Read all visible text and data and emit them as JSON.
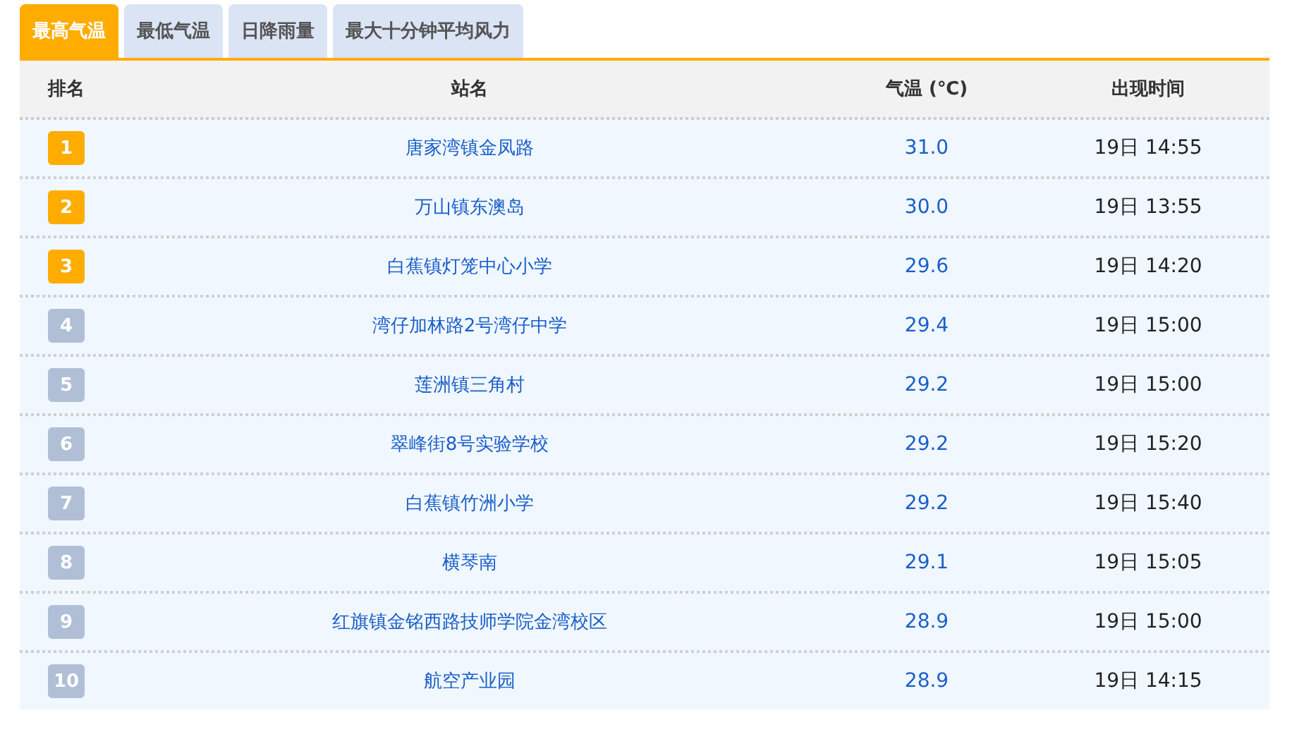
{
  "tabs": [
    {
      "label": "最高气温",
      "selected": true
    },
    {
      "label": "最低气温",
      "selected": false
    },
    {
      "label": "日降雨量",
      "selected": false
    },
    {
      "label": "最大十分钟平均风力",
      "selected": false
    }
  ],
  "table": {
    "columns": [
      "排名",
      "站名",
      "气温 (℃)",
      "出现时间"
    ],
    "rows": [
      {
        "rank": "1",
        "color": "#ffac00",
        "station": "唐家湾镇金凤路",
        "temp": "31.0",
        "time": "19日 14:55"
      },
      {
        "rank": "2",
        "color": "#ffac00",
        "station": "万山镇东澳岛",
        "temp": "30.0",
        "time": "19日 13:55"
      },
      {
        "rank": "3",
        "color": "#ffac00",
        "station": "白蕉镇灯笼中心小学",
        "temp": "29.6",
        "time": "19日 14:20"
      },
      {
        "rank": "4",
        "color": "#b0bfd6",
        "station": "湾仔加林路2号湾仔中学",
        "temp": "29.4",
        "time": "19日 15:00"
      },
      {
        "rank": "5",
        "color": "#b0bfd6",
        "station": "莲洲镇三角村",
        "temp": "29.2",
        "time": "19日 15:00"
      },
      {
        "rank": "6",
        "color": "#b0bfd6",
        "station": "翠峰街8号实验学校",
        "temp": "29.2",
        "time": "19日 15:20"
      },
      {
        "rank": "7",
        "color": "#b0bfd6",
        "station": "白蕉镇竹洲小学",
        "temp": "29.2",
        "time": "19日 15:40"
      },
      {
        "rank": "8",
        "color": "#b0bfd6",
        "station": "横琴南",
        "temp": "29.1",
        "time": "19日 15:05"
      },
      {
        "rank": "9",
        "color": "#b0bfd6",
        "station": "红旗镇金铭西路技师学院金湾校区",
        "temp": "28.9",
        "time": "19日 15:00"
      },
      {
        "rank": "10",
        "color": "#b0bfd6",
        "station": "航空产业园",
        "temp": "28.9",
        "time": "19日 14:15"
      }
    ]
  }
}
